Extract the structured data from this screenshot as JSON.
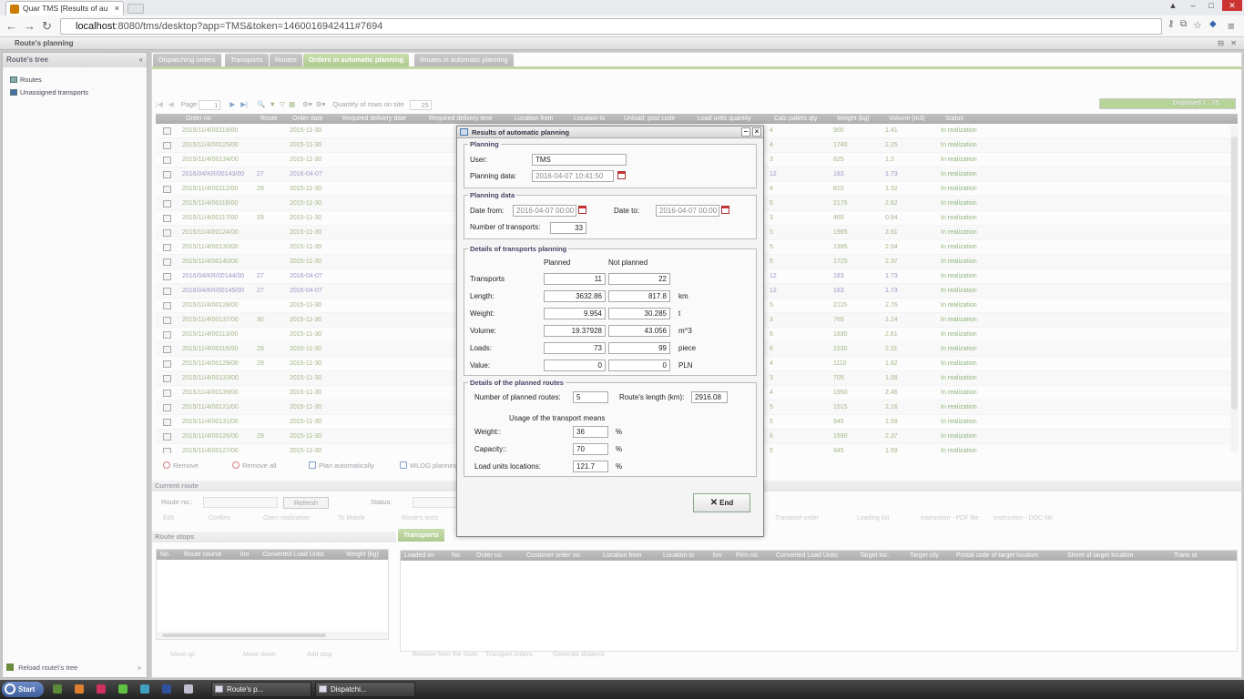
{
  "browser": {
    "tab_title": "Quar TMS [Results of au",
    "url_host": "localhost",
    "url_path": ":8080/tms/desktop?app=TMS&token=1460016942411#7694"
  },
  "app": {
    "title": "Route's planning",
    "left": {
      "header": "Route's tree",
      "items": [
        "Routes",
        "Unassigned transports"
      ],
      "reload": "Reload route\\'s tree"
    },
    "tabs": [
      {
        "label": "Dispatching orders",
        "active": false
      },
      {
        "label": "Transports",
        "active": false
      },
      {
        "label": "Routes",
        "active": false
      },
      {
        "label": "Orders in automatic planning",
        "active": true
      },
      {
        "label": "Routes in automatic planning",
        "active": false
      }
    ],
    "toolbar": {
      "page_label": "Page",
      "page_value": "1",
      "rows_label": "Quantity of rows on site",
      "rows_value": "25",
      "displayed": "Displayed 1 - 25",
      "displayed_fraction": 1.0
    },
    "grid": {
      "columns": [
        "Order no",
        "Route",
        "Order date",
        "Required delivery date",
        "Required delivery time",
        "Location from",
        "Location to",
        "Unload. post code",
        "Load units quantity",
        "Calc pallets qty",
        "Weight (kg)",
        "Volume (m3)",
        "Status"
      ],
      "rows": [
        [
          "2015/11/4/00119/00",
          "",
          "2015-11-30",
          "4",
          "900",
          "1.41",
          "In realization"
        ],
        [
          "2015/11/4/00125/00",
          "",
          "2015-11-30",
          "4",
          "1740",
          "2.25",
          "In realization"
        ],
        [
          "2015/11/4/00134/00",
          "",
          "2015-11-30",
          "3",
          "825",
          "1.2",
          "In realization"
        ],
        [
          "2016/04/KR/00143/00",
          "27",
          "2016-04-07",
          "12",
          "183",
          "1.73",
          "In realization"
        ],
        [
          "2015/11/4/00112/00",
          "29",
          "2015-11-30",
          "4",
          "810",
          "1.32",
          "In realization"
        ],
        [
          "2015/11/4/00116/00",
          "",
          "2015-11-30",
          "5",
          "2175",
          "2.82",
          "In realization"
        ],
        [
          "2015/11/4/00117/00",
          "29",
          "2015-11-30",
          "3",
          "465",
          "0.84",
          "In realization"
        ],
        [
          "2015/11/4/00124/00",
          "",
          "2015-11-30",
          "5",
          "1965",
          "2.61",
          "In realization"
        ],
        [
          "2015/11/4/00130/00",
          "",
          "2015-11-30",
          "5",
          "1395",
          "2.04",
          "In realization"
        ],
        [
          "2015/11/4/00140/00",
          "",
          "2015-11-30",
          "5",
          "1725",
          "2.37",
          "In realization"
        ],
        [
          "2016/04/KR/00144/00",
          "27",
          "2016-04-07",
          "12",
          "183",
          "1.73",
          "In realization"
        ],
        [
          "2016/04/KR/00145/00",
          "27",
          "2016-04-07",
          "12",
          "183",
          "1.73",
          "In realization"
        ],
        [
          "2015/11/4/00128/00",
          "",
          "2015-11-30",
          "5",
          "2115",
          "2.76",
          "In realization"
        ],
        [
          "2015/11/4/00137/00",
          "30",
          "2015-11-30",
          "3",
          "765",
          "1.14",
          "In realization"
        ],
        [
          "2015/11/4/00113/00",
          "",
          "2015-11-30",
          "6",
          "1830",
          "2.61",
          "In realization"
        ],
        [
          "2015/11/4/00115/00",
          "29",
          "2015-11-30",
          "6",
          "1530",
          "2.31",
          "In realization"
        ],
        [
          "2015/11/4/00129/00",
          "29",
          "2015-11-30",
          "4",
          "1110",
          "1.62",
          "In realization"
        ],
        [
          "2015/11/4/00133/00",
          "",
          "2015-11-30",
          "3",
          "705",
          "1.08",
          "In realization"
        ],
        [
          "2015/11/4/00139/00",
          "",
          "2015-11-30",
          "4",
          "1950",
          "2.46",
          "In realization"
        ],
        [
          "2015/11/4/00121/00",
          "",
          "2015-11-30",
          "5",
          "1515",
          "2.16",
          "In realization"
        ],
        [
          "2015/11/4/00131/00",
          "",
          "2015-11-30",
          "5",
          "945",
          "1.59",
          "In realization"
        ],
        [
          "2015/11/4/00126/00",
          "29",
          "2015-11-30",
          "6",
          "1590",
          "2.37",
          "In realization"
        ],
        [
          "2015/11/4/00127/00",
          "",
          "2015-11-30",
          "5",
          "945",
          "1.59",
          "In realization"
        ]
      ]
    },
    "actions": [
      "Remove",
      "Remove all",
      "Plan automatically",
      "WLOG planning"
    ],
    "current_route": {
      "header": "Current route",
      "route_no_label": "Route no.:",
      "refresh": "Refresh",
      "status_label": "Status:",
      "buttons": [
        "Edit",
        "Confirm",
        "Open realization",
        "To Mobile",
        "Route's tests",
        "Transport order",
        "Loading list",
        "Instruction - PDF file",
        "Instruction - DOC file"
      ]
    },
    "stops": {
      "header": "Route stops",
      "columns": [
        "No.",
        "Route course",
        "km",
        "Converted Load Units",
        "Weight (kg)"
      ]
    },
    "transports": {
      "tab": "Transports",
      "columns": [
        "Loaded on",
        "No.",
        "Order no.",
        "Customer order no.",
        "Location from",
        "Location to",
        "km",
        "Firm no.",
        "Converted Load Units",
        "Target loc.",
        "Target city",
        "Postal code of target location",
        "Street of target location",
        "Trans st."
      ]
    },
    "bottom_buttons": [
      "Move up",
      "Move down",
      "Add stop",
      "Remove from the route",
      "Transport orders",
      "Generate distance"
    ]
  },
  "dialog": {
    "title": "Results of automatic planning",
    "planning": {
      "legend": "Planning",
      "user_label": "User:",
      "user_value": "TMS",
      "date_label": "Planning data:",
      "date_value": "2016-04-07 10:41:50"
    },
    "planning_data": {
      "legend": "Planning data",
      "from_label": "Date from:",
      "from_value": "2016-04-07 00:00",
      "to_label": "Date to:",
      "to_value": "2016-04-07 00:00",
      "num_label": "Number of transports:",
      "num_value": "33"
    },
    "details": {
      "legend": "Details of transports planning",
      "planned_hdr": "Planned",
      "notplanned_hdr": "Not planned",
      "rows": [
        {
          "label": "Transports",
          "planned": "11",
          "not_planned": "22",
          "unit": ""
        },
        {
          "label": "Length:",
          "planned": "3632.86",
          "not_planned": "817.8",
          "unit": "km"
        },
        {
          "label": "Weight:",
          "planned": "9.954",
          "not_planned": "30.285",
          "unit": "t"
        },
        {
          "label": "Volume:",
          "planned": "19.37928",
          "not_planned": "43.056",
          "unit": "m^3"
        },
        {
          "label": "Loads:",
          "planned": "73",
          "not_planned": "99",
          "unit": "piece"
        },
        {
          "label": "Value:",
          "planned": "0",
          "not_planned": "0",
          "unit": "PLN"
        }
      ]
    },
    "routes": {
      "legend": "Details of the planned routes",
      "num_label": "Number of planned routes:",
      "num_value": "5",
      "length_label": "Route's length (km):",
      "length_value": "2916.08",
      "usage_label": "Usage of the transport means",
      "weight_label": "Weight::",
      "weight_value": "36",
      "capacity_label": "Capacity::",
      "capacity_value": "70",
      "lul_label": "Load units locations:",
      "lul_value": "121.7",
      "pct": "%"
    },
    "end_label": "End"
  },
  "taskbar": {
    "start": "Start",
    "windows": [
      "Route's p...",
      "Dispatchi..."
    ]
  }
}
